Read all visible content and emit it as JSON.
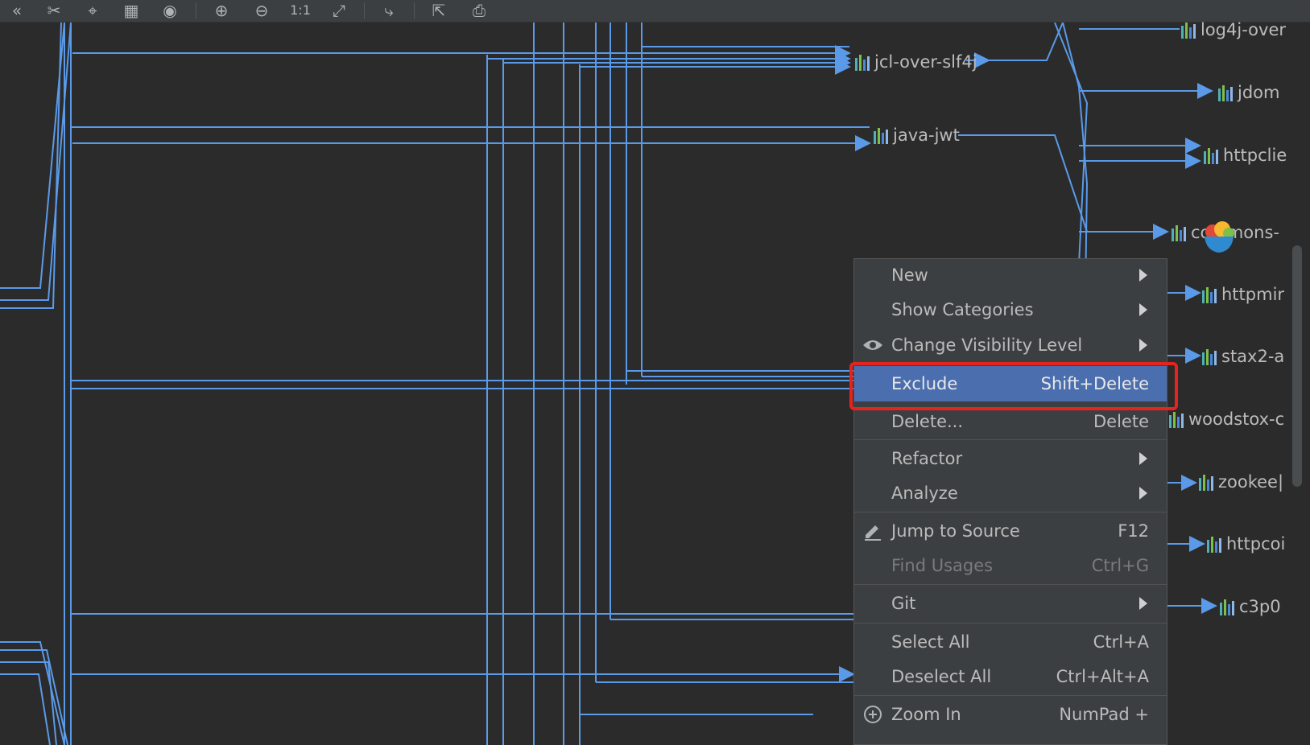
{
  "toolbar": {
    "icons": [
      "collapse-left-icon",
      "cut-icon",
      "cursor-select-icon",
      "layout-icon",
      "eye-icon",
      "zoom-in-icon",
      "zoom-out-icon",
      "actual-size-icon",
      "fit-content-icon",
      "route-edges-icon",
      "export-icon",
      "print-icon"
    ]
  },
  "graph": {
    "nodes": {
      "log4j": "log4j-over",
      "jcl": "jcl-over-slf4j",
      "jdom": "jdom",
      "javajwt": "java-jwt",
      "httpclient": "httpclie",
      "commons": "commons-",
      "httpmime": "httpmir",
      "stax2": "stax2-a",
      "woodstox": "woodstox-c",
      "zookeeper": "zookee|",
      "httpcore": "httpcoi",
      "c3p0": "c3p0"
    },
    "colors": {
      "edge": "#5a9ae8",
      "bar_teal": "#4fb0b5",
      "bar_green": "#7cbf4a",
      "bar_blue": "#4a88d8",
      "bar_light": "#8fb8e8"
    }
  },
  "menu": {
    "new": "New",
    "show_categories": "Show Categories",
    "change_visibility": "Change Visibility Level",
    "exclude": "Exclude",
    "exclude_sc": "Shift+Delete",
    "delete": "Delete...",
    "delete_sc": "Delete",
    "refactor": "Refactor",
    "analyze": "Analyze",
    "jump_to_source": "Jump to Source",
    "jump_to_source_sc": "F12",
    "find_usages": "Find Usages",
    "find_usages_sc": "Ctrl+G",
    "git": "Git",
    "select_all": "Select All",
    "select_all_sc": "Ctrl+A",
    "deselect_all": "Deselect All",
    "deselect_all_sc": "Ctrl+Alt+A",
    "zoom_in": "Zoom In",
    "zoom_in_sc": "NumPad +"
  },
  "colors": {
    "menu_selected": "#4b6eaf",
    "highlight_box": "#e6241e"
  }
}
